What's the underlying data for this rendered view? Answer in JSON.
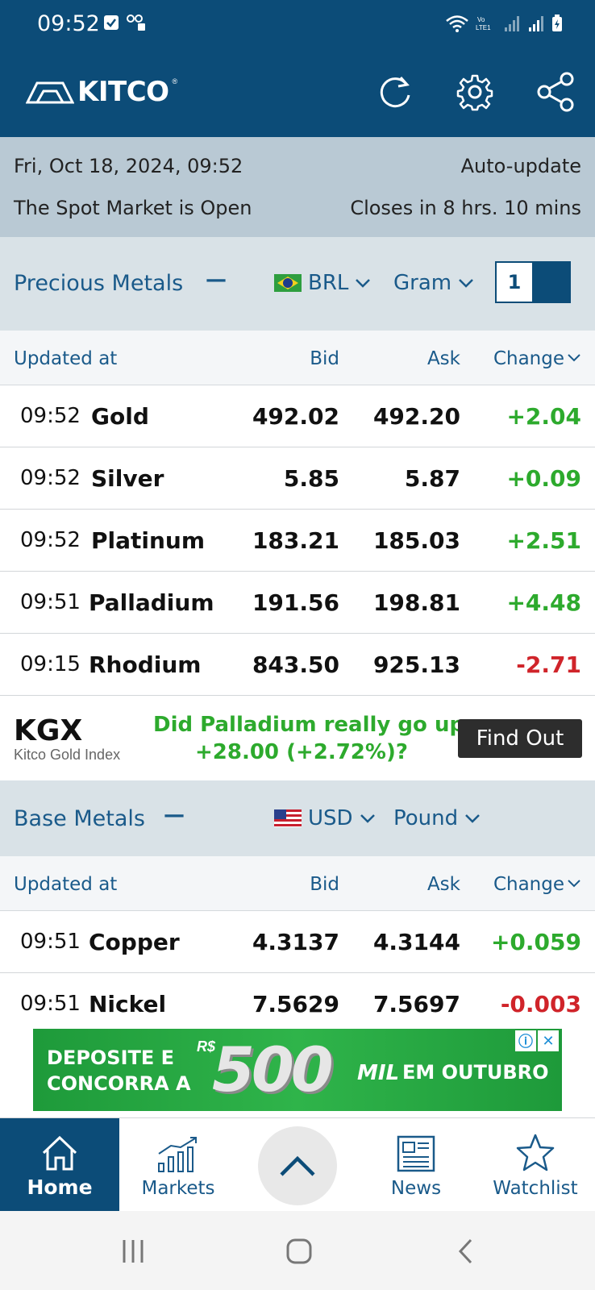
{
  "status_bar": {
    "time": "09:52",
    "icons": [
      "check-notification-icon",
      "voicemail-icon",
      "wifi-icon",
      "volte-icon",
      "signal-icon",
      "signal-icon",
      "battery-icon"
    ]
  },
  "app": {
    "logo": "KITCO",
    "actions": [
      "refresh-icon",
      "settings-icon",
      "share-icon"
    ]
  },
  "info": {
    "datetime": "Fri, Oct 18, 2024, 09:52",
    "auto_update": "Auto-update",
    "market_status": "The Spot Market is Open",
    "closes_in": "Closes in 8 hrs. 10 mins"
  },
  "precious": {
    "title": "Precious Metals",
    "currency": "BRL",
    "unit": "Gram",
    "quantity": "1",
    "columns": {
      "updated": "Updated at",
      "bid": "Bid",
      "ask": "Ask",
      "change": "Change"
    },
    "rows": [
      {
        "time": "09:52",
        "name": "Gold",
        "bid": "492.02",
        "ask": "492.20",
        "change": "+2.04"
      },
      {
        "time": "09:52",
        "name": "Silver",
        "bid": "5.85",
        "ask": "5.87",
        "change": "+0.09"
      },
      {
        "time": "09:52",
        "name": "Platinum",
        "bid": "183.21",
        "ask": "185.03",
        "change": "+2.51"
      },
      {
        "time": "09:51",
        "name": "Palladium",
        "bid": "191.56",
        "ask": "198.81",
        "change": "+4.48"
      },
      {
        "time": "09:15",
        "name": "Rhodium",
        "bid": "843.50",
        "ask": "925.13",
        "change": "-2.71"
      }
    ]
  },
  "kgx": {
    "logo": "KGX",
    "subtitle": "Kitco Gold Index",
    "question_line1": "Did Palladium really go up",
    "question_line2": "+28.00 (+2.72%)?",
    "button": "Find Out"
  },
  "base": {
    "title": "Base Metals",
    "currency": "USD",
    "unit": "Pound",
    "columns": {
      "updated": "Updated at",
      "bid": "Bid",
      "ask": "Ask",
      "change": "Change"
    },
    "rows": [
      {
        "time": "09:51",
        "name": "Copper",
        "bid": "4.3137",
        "ask": "4.3144",
        "change": "+0.059"
      },
      {
        "time": "09:51",
        "name": "Nickel",
        "bid": "7.5629",
        "ask": "7.5697",
        "change": "-0.003"
      }
    ]
  },
  "ad": {
    "line1": "DEPOSITE E",
    "line2": "CONCORRA A",
    "currency": "R$",
    "amount": "500",
    "mil": "MIL",
    "rest": "EM OUTUBRO"
  },
  "nav": {
    "home": "Home",
    "markets": "Markets",
    "news": "News",
    "watchlist": "Watchlist"
  },
  "colors": {
    "primary": "#0c4c78",
    "positive": "#2daa2d",
    "negative": "#d0242a"
  }
}
